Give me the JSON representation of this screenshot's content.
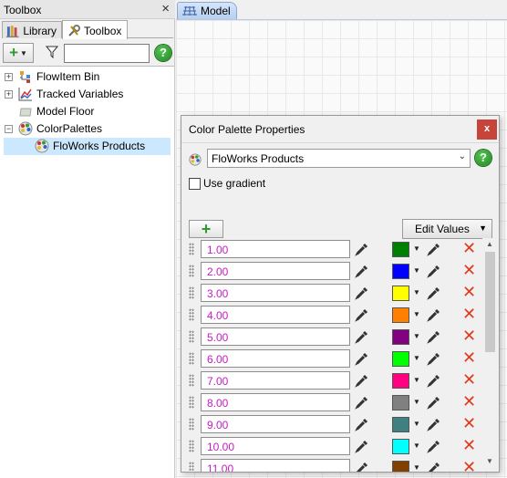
{
  "toolbox": {
    "title": "Toolbox",
    "close": "×",
    "tabs": [
      {
        "label": "Library",
        "icon": "library-icon",
        "active": false
      },
      {
        "label": "Toolbox",
        "icon": "toolbox-icon",
        "active": true
      }
    ],
    "filter_value": "",
    "help": "?",
    "tree": [
      {
        "label": "FlowItem Bin",
        "icon": "flowitem-bin-icon",
        "expander": "+"
      },
      {
        "label": "Tracked Variables",
        "icon": "chart-icon",
        "expander": "+"
      },
      {
        "label": "Model Floor",
        "icon": "floor-icon",
        "expander": ""
      },
      {
        "label": "ColorPalettes",
        "icon": "color-palette-icon",
        "expander": "−"
      },
      {
        "label": "FloWorks Products",
        "icon": "color-palette-icon",
        "expander": "",
        "selected": true
      }
    ]
  },
  "document": {
    "tab_label": "Model"
  },
  "dialog": {
    "title": "Color Palette Properties",
    "close": "x",
    "palette_name": "FloWorks Products",
    "help": "?",
    "use_gradient_label": "Use gradient",
    "use_gradient_checked": false,
    "add_label": "+",
    "edit_values_label": "Edit Values",
    "entries": [
      {
        "value": "1.00",
        "color": "#008000"
      },
      {
        "value": "2.00",
        "color": "#0000ff"
      },
      {
        "value": "3.00",
        "color": "#ffff00"
      },
      {
        "value": "4.00",
        "color": "#ff8000"
      },
      {
        "value": "5.00",
        "color": "#800080"
      },
      {
        "value": "6.00",
        "color": "#00ff00"
      },
      {
        "value": "7.00",
        "color": "#ff0080"
      },
      {
        "value": "8.00",
        "color": "#808080"
      },
      {
        "value": "9.00",
        "color": "#408080"
      },
      {
        "value": "10.00",
        "color": "#00ffff"
      },
      {
        "value": "11.00",
        "color": "#804000"
      }
    ]
  },
  "colors": {
    "value_text": "#c020c0",
    "selection": "#cce8ff",
    "delete_icon": "#e23a1a",
    "help_button": "#2f9a2f"
  }
}
